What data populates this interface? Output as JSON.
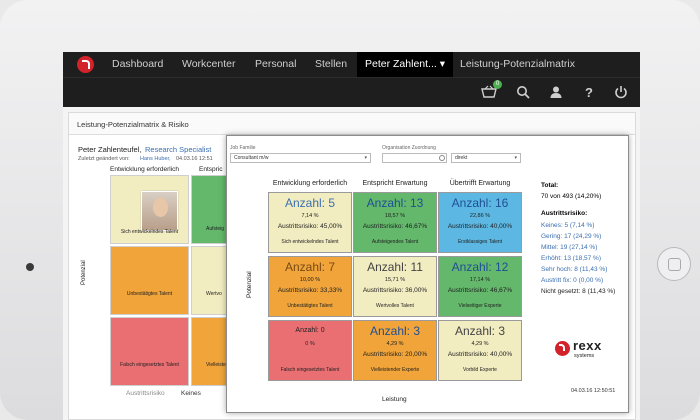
{
  "nav": {
    "items": [
      {
        "label": "Dashboard"
      },
      {
        "label": "Workcenter"
      },
      {
        "label": "Personal"
      },
      {
        "label": "Stellen"
      },
      {
        "label": "Peter Zahlent... ▾"
      },
      {
        "label": "Leistung-Potenzialmatrix"
      }
    ],
    "cart_count": "0"
  },
  "page": {
    "title": "Leistung-Potenzialmatrix & Risiko",
    "person_name": "Peter Zahlenteufel,",
    "person_role": "Research Specialist",
    "changed_prefix": "Zuletzt geändert von:",
    "changed_by": "Hans Huber,",
    "changed_date": "04.03.16 12:51",
    "bg_col1": "Entwicklung erforderlich",
    "bg_col2": "Entspric",
    "bg_ylabel": "Potenzial",
    "bg_cells": [
      {
        "label": "Sich entwickelndes Talent",
        "color": "#f2ecc1"
      },
      {
        "label": "Aufsteig",
        "color": "#63b86b"
      },
      {
        "label": "Unbestätigtes Talent",
        "color": "#f0a43a"
      },
      {
        "label": "Wertvo",
        "color": "#f2ecc1"
      },
      {
        "label": "Falsch eingesetztes Talent",
        "color": "#ea6f72"
      },
      {
        "label": "Vielleiste",
        "color": "#f0a43a"
      }
    ],
    "bg_bottom_label": "Austrittsrisiko",
    "bg_bottom_value": "Keines"
  },
  "overlay": {
    "job_family_label": "Job Familie",
    "job_family_value": "Consultant m/w",
    "org_label": "Organisation Zuordnung",
    "org_value": "",
    "direct_value": "direkt",
    "columns": [
      "Entwicklung erforderlich",
      "Entspricht Erwartung",
      "Übertrifft Erwartung"
    ],
    "ylabel": "Potenzial",
    "xlabel": "Leistung",
    "cells": [
      {
        "count": "Anzahl: 5",
        "pct": "7,14 %",
        "risk": "Austrittsrisiko: 45,00%",
        "name": "Sich entwickelndes Talent",
        "color": "#f2ecc1",
        "text_color": "#3a6fb0",
        "small": false
      },
      {
        "count": "Anzahl: 13",
        "pct": "18,57 %",
        "risk": "Austrittsrisiko: 46,67%",
        "name": "Aufsteigendes Talent",
        "color": "#63b86b",
        "text_color": "#1f4f96",
        "small": false
      },
      {
        "count": "Anzahl: 16",
        "pct": "22,86 %",
        "risk": "Austrittsrisiko: 40,00%",
        "name": "Erstklassiges Talent",
        "color": "#5cb8e3",
        "text_color": "#1f4f96",
        "small": false
      },
      {
        "count": "Anzahl: 7",
        "pct": "10,00 %",
        "risk": "Austrittsrisiko: 33,33%",
        "name": "Unbestätigtes Talent",
        "color": "#f0a43a",
        "text_color": "#7a4a12",
        "small": false
      },
      {
        "count": "Anzahl: 11",
        "pct": "15,71 %",
        "risk": "Austrittsrisiko: 36,00%",
        "name": "Wertvolles Talent",
        "color": "#f2ecc1",
        "text_color": "#444444",
        "small": false
      },
      {
        "count": "Anzahl: 12",
        "pct": "17,14 %",
        "risk": "Austrittsrisiko: 46,67%",
        "name": "Vielseitiger Experte",
        "color": "#63b86b",
        "text_color": "#1f4f96",
        "small": false
      },
      {
        "count": "Anzahl: 0",
        "pct": "0 %",
        "risk": "",
        "name": "Falsch eingesetztes Talent",
        "color": "#ea6f72",
        "text_color": "#222222",
        "small": true
      },
      {
        "count": "Anzahl: 3",
        "pct": "4,29 %",
        "risk": "Austrittsrisiko: 20,00%",
        "name": "Vielleistender Experte",
        "color": "#f0a43a",
        "text_color": "#1f4f96",
        "small": false
      },
      {
        "count": "Anzahl: 3",
        "pct": "4,29 %",
        "risk": "Austrittsrisiko: 40,00%",
        "name": "Vorbild Experte",
        "color": "#f2ecc1",
        "text_color": "#444444",
        "small": false
      }
    ],
    "stats": {
      "total_label": "Total:",
      "total_value": "70 von 493 (14,20%)",
      "risk_label": "Austrittsrisiko:",
      "rows": [
        {
          "label": "Keines: 5 (7,14 %)",
          "link": true
        },
        {
          "label": "Gering: 17 (24,29 %)",
          "link": true
        },
        {
          "label": "Mittel: 19 (27,14 %)",
          "link": true
        },
        {
          "label": "Erhöht: 13 (18,57 %)",
          "link": true
        },
        {
          "label": "Sehr hoch: 8 (11,43 %)",
          "link": true
        },
        {
          "label": "Austritt fix: 0 (0,00 %)",
          "link": true
        },
        {
          "label": "Nicht gesetzt: 8 (11,43 %)",
          "link": false
        }
      ]
    },
    "brand_word1": "rexx",
    "brand_word2": "systems",
    "timestamp": "04.03.16 12:50:51"
  }
}
